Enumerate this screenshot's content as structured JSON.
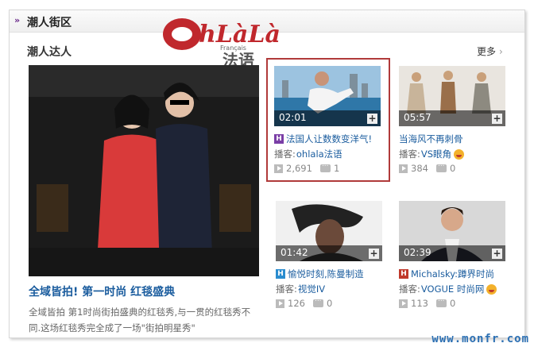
{
  "header": {
    "arrows": "»",
    "title": "潮人街区"
  },
  "logo": {
    "brand": "OhLàLà",
    "sub": "Français",
    "cn": "法语"
  },
  "section": {
    "title": "潮人达人",
    "more": "更多",
    "more_chev": "›"
  },
  "featured": {
    "title": "全域皆拍! 第一时尚 红毯盛典",
    "desc": "全域皆拍 第1时尚街拍盛典的红毯秀,与一贯的红毯秀不同.这场红毯秀完全成了一场\"街拍明星秀\""
  },
  "cards": [
    {
      "duration": "02:01",
      "badge": "H",
      "title": "法国人让数数变洋气!",
      "author_label": "播客: ",
      "author": "ohlala法语",
      "plays": "2,691",
      "comments": "1"
    },
    {
      "duration": "05:57",
      "badge": "",
      "title": "当海风不再刺骨",
      "author_label": "播客: ",
      "author": "VS眼角",
      "plays": "384",
      "comments": "0"
    },
    {
      "duration": "01:42",
      "badge": "H",
      "title": "愉悦时刻,陈曼制造",
      "author_label": "播客: ",
      "author": "视觉IV",
      "plays": "126",
      "comments": "0"
    },
    {
      "duration": "02:39",
      "badge": "H",
      "title": "Michalsky:蹲界时尚",
      "author_label": "播客: ",
      "author": "VOGUE 时尚网",
      "plays": "113",
      "comments": "0"
    }
  ],
  "watermark": "www.monfr.com",
  "colors": {
    "link": "#1a5c9e",
    "highlight": "#b03a3a",
    "logo_red": "#c0282d"
  }
}
